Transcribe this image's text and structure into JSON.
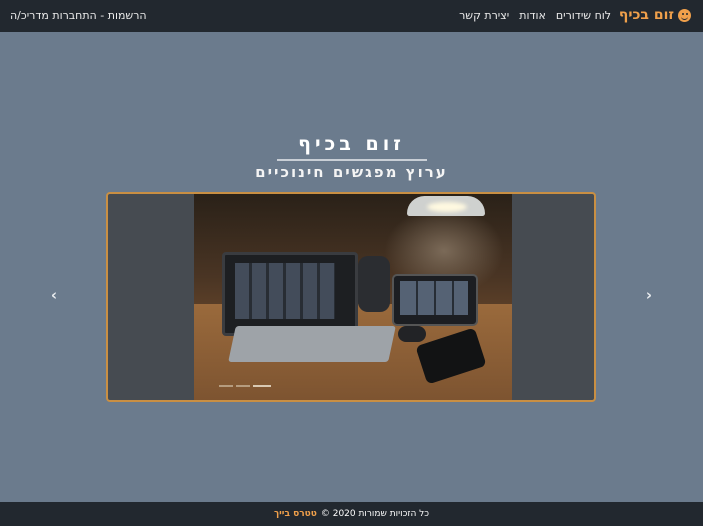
{
  "navbar": {
    "brand": "זום בכיף",
    "brand_icon": "smiley-icon",
    "links": [
      "לוח שידורים",
      "אודות",
      "יצירת קשר"
    ],
    "register_link": "הרשמות - התחברות מדריכ/ה"
  },
  "hero": {
    "title": "זום בכיף",
    "subtitle": "ערוץ מפגשים חינוכיים"
  },
  "carousel": {
    "prev_icon": "chevron-left-icon",
    "next_icon": "chevron-right-icon",
    "slide_count": 3,
    "active_index": 2
  },
  "footer": {
    "text": "כל הזכויות שמורות 2020 ©",
    "brand_link": "טטרס בייך"
  },
  "colors": {
    "navbar_bg": "#22282f",
    "page_bg": "#6b7b8d",
    "accent": "#f0a04b"
  }
}
